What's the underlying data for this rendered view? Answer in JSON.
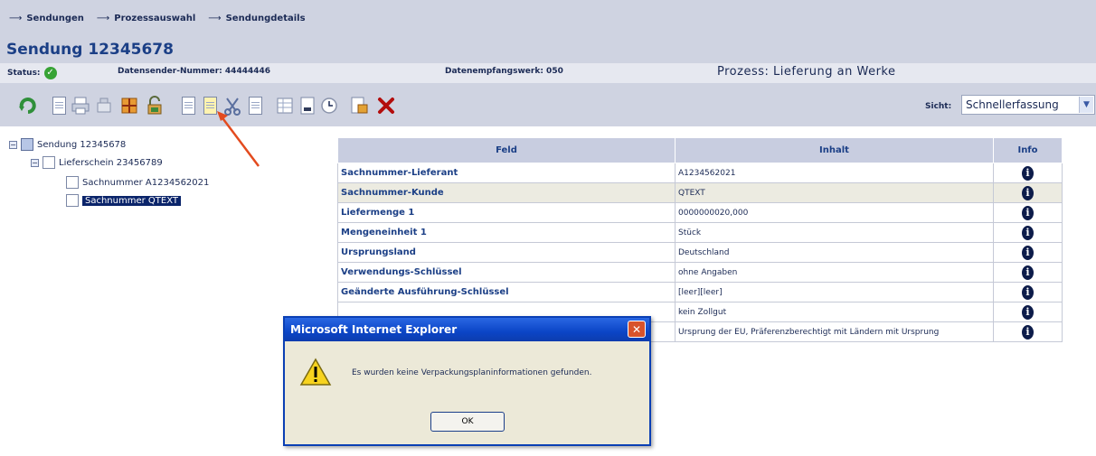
{
  "breadcrumb": {
    "arrow": "⟶",
    "items": [
      "Sendungen",
      "Prozessauswahl",
      "Sendungdetails"
    ]
  },
  "page_title": "Sendung 12345678",
  "status_row": {
    "status_label": "Status:",
    "status_icon": "green-check-icon",
    "sender_label": "Datensender-Nummer: 44444446",
    "werk_label": "Datenempfangswerk: 050",
    "prozess_label": "Prozess: Lieferung an Werke"
  },
  "toolbar": {
    "icons": [
      "refresh-icon",
      "document-icon",
      "print-icon",
      "scale-icon",
      "grid-icon",
      "unlock-icon",
      "copy-icon",
      "copy-alt-icon",
      "cut-icon",
      "paste-icon",
      "table-icon",
      "export-icon",
      "clock-icon",
      "edit-icon",
      "delete-icon"
    ],
    "sicht_label": "Sicht:",
    "sicht_value": "Schnellerfassung"
  },
  "tree": {
    "root": "Sendung 12345678",
    "child": "Lieferschein 23456789",
    "leaf1": "Sachnummer A1234562021",
    "leaf2": "Sachnummer QTEXT"
  },
  "table": {
    "headers": [
      "Feld",
      "Inhalt",
      "Info"
    ],
    "rows": [
      {
        "feld": "Sachnummer-Lieferant",
        "inhalt": "A1234562021"
      },
      {
        "feld": "Sachnummer-Kunde",
        "inhalt": "QTEXT"
      },
      {
        "feld": "Liefermenge 1",
        "inhalt": "0000000020,000"
      },
      {
        "feld": "Mengeneinheit 1",
        "inhalt": "Stück"
      },
      {
        "feld": "Ursprungsland",
        "inhalt": "Deutschland"
      },
      {
        "feld": "Verwendungs-Schlüssel",
        "inhalt": "ohne Angaben"
      },
      {
        "feld": "Geänderte Ausführung-Schlüssel",
        "inhalt": "[leer][leer]"
      },
      {
        "feld": "",
        "inhalt": "kein Zollgut"
      },
      {
        "feld": "",
        "inhalt": "Ursprung der EU, Präferenzberechtigt mit Ländern mit Ursprung"
      }
    ]
  },
  "dialog": {
    "title": "Microsoft Internet Explorer",
    "message": "Es wurden keine Verpackungsplaninformationen gefunden.",
    "ok_label": "OK"
  }
}
